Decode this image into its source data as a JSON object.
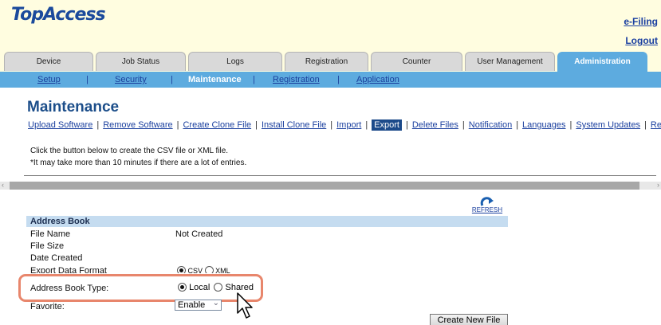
{
  "header": {
    "logo": "TopAccess",
    "efiling_link": "e-Filing",
    "logout_link": "Logout",
    "colors": {
      "header_bg": "#fffde0",
      "tab_active": "#5dabdf",
      "subnav_bg": "#5dabdf",
      "title": "#1c4e8a"
    }
  },
  "tabs": [
    {
      "label": "Device"
    },
    {
      "label": "Job Status"
    },
    {
      "label": "Logs"
    },
    {
      "label": "Registration"
    },
    {
      "label": "Counter"
    },
    {
      "label": "User Management"
    },
    {
      "label": "Administration",
      "active": true
    }
  ],
  "subnav": {
    "items": [
      {
        "label": "Setup"
      },
      {
        "label": "Security"
      },
      {
        "label": "Maintenance",
        "current": true
      },
      {
        "label": "Registration"
      },
      {
        "label": "Application"
      }
    ]
  },
  "page": {
    "title": "Maintenance",
    "links": [
      {
        "label": "Upload Software"
      },
      {
        "label": "Remove Software"
      },
      {
        "label": "Create Clone File"
      },
      {
        "label": "Install Clone File"
      },
      {
        "label": "Import"
      },
      {
        "label": "Export",
        "active": true
      },
      {
        "label": "Delete Files"
      },
      {
        "label": "Notification"
      },
      {
        "label": "Languages"
      },
      {
        "label": "System Updates"
      },
      {
        "label": "Re"
      }
    ],
    "info_line1": "Click the button below to create the CSV file or XML file.",
    "info_line2": "*It may take more than 10 minutes if there are a lot of entries.",
    "refresh_label": "REFRESH"
  },
  "address_book": {
    "heading": "Address Book",
    "file_name_label": "File Name",
    "file_name_value": "Not Created",
    "file_size_label": "File Size",
    "date_created_label": "Date Created",
    "export_format_label": "Export Data Format",
    "export_format_options": [
      "CSV",
      "XML"
    ],
    "export_format_selected": "CSV",
    "type_label": "Address Book Type:",
    "type_options": [
      "Local",
      "Shared"
    ],
    "type_selected": "Local",
    "favorite_label": "Favorite:",
    "favorite_value": "Enable",
    "create_button": "Create New File"
  }
}
